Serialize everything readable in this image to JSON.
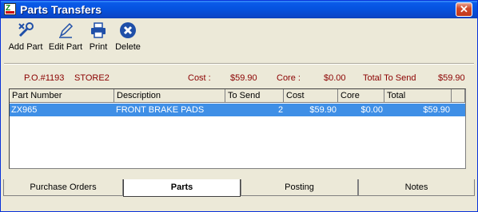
{
  "window": {
    "title": "Parts Transfers",
    "close_label": "✕"
  },
  "toolbar": {
    "add_part": "Add Part",
    "edit_part": "Edit Part",
    "print": "Print",
    "delete": "Delete"
  },
  "info": {
    "po": "P.O.#1193",
    "store": "STORE2",
    "cost_label": "Cost :",
    "cost_value": "$59.90",
    "core_label": "Core :",
    "core_value": "$0.00",
    "total_label": "Total To Send",
    "total_value": "$59.90"
  },
  "grid": {
    "columns": [
      "Part Number",
      "Description",
      "To Send",
      "Cost",
      "Core",
      "Total"
    ],
    "rows": [
      {
        "part_number": "ZX965",
        "description": "FRONT BRAKE PADS",
        "to_send": "2",
        "cost": "$59.90",
        "core": "$0.00",
        "total": "$59.90"
      }
    ]
  },
  "tabs": [
    "Purchase Orders",
    "Parts",
    "Posting",
    "Notes"
  ],
  "active_tab": "Parts",
  "colors": {
    "title_bar": "#0a5ae8",
    "selection": "#3f8fe6",
    "info_text": "#8b0000"
  }
}
